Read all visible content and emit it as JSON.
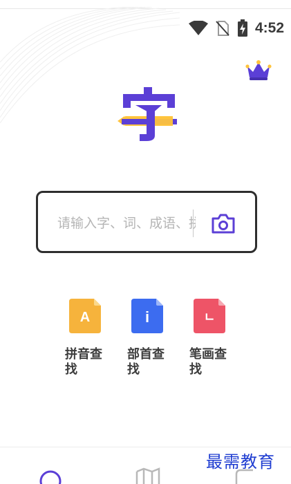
{
  "status_bar": {
    "time": "4:52",
    "icons": [
      "wifi-icon",
      "no-sim-icon",
      "battery-charging-icon"
    ]
  },
  "header": {
    "premium_icon": "crown-icon",
    "logo_char": "字"
  },
  "search": {
    "placeholder": "请输入字、词、成语、拼音",
    "camera_icon": "camera-icon"
  },
  "lookup": [
    {
      "label": "拼音查找",
      "glyph": "A",
      "color": "#F6B33C"
    },
    {
      "label": "部首查找",
      "glyph": "i",
      "color": "#3C6CF0"
    },
    {
      "label": "笔画查找",
      "glyph": "ㄴ",
      "color": "#EE5467"
    }
  ],
  "bottom_nav": {
    "items": [
      "search-tab-icon",
      "book-tab-icon",
      "profile-tab-icon"
    ]
  },
  "watermark": "最需教育",
  "colors": {
    "accent": "#5B3FD6",
    "logo_yellow": "#FFC43D"
  }
}
